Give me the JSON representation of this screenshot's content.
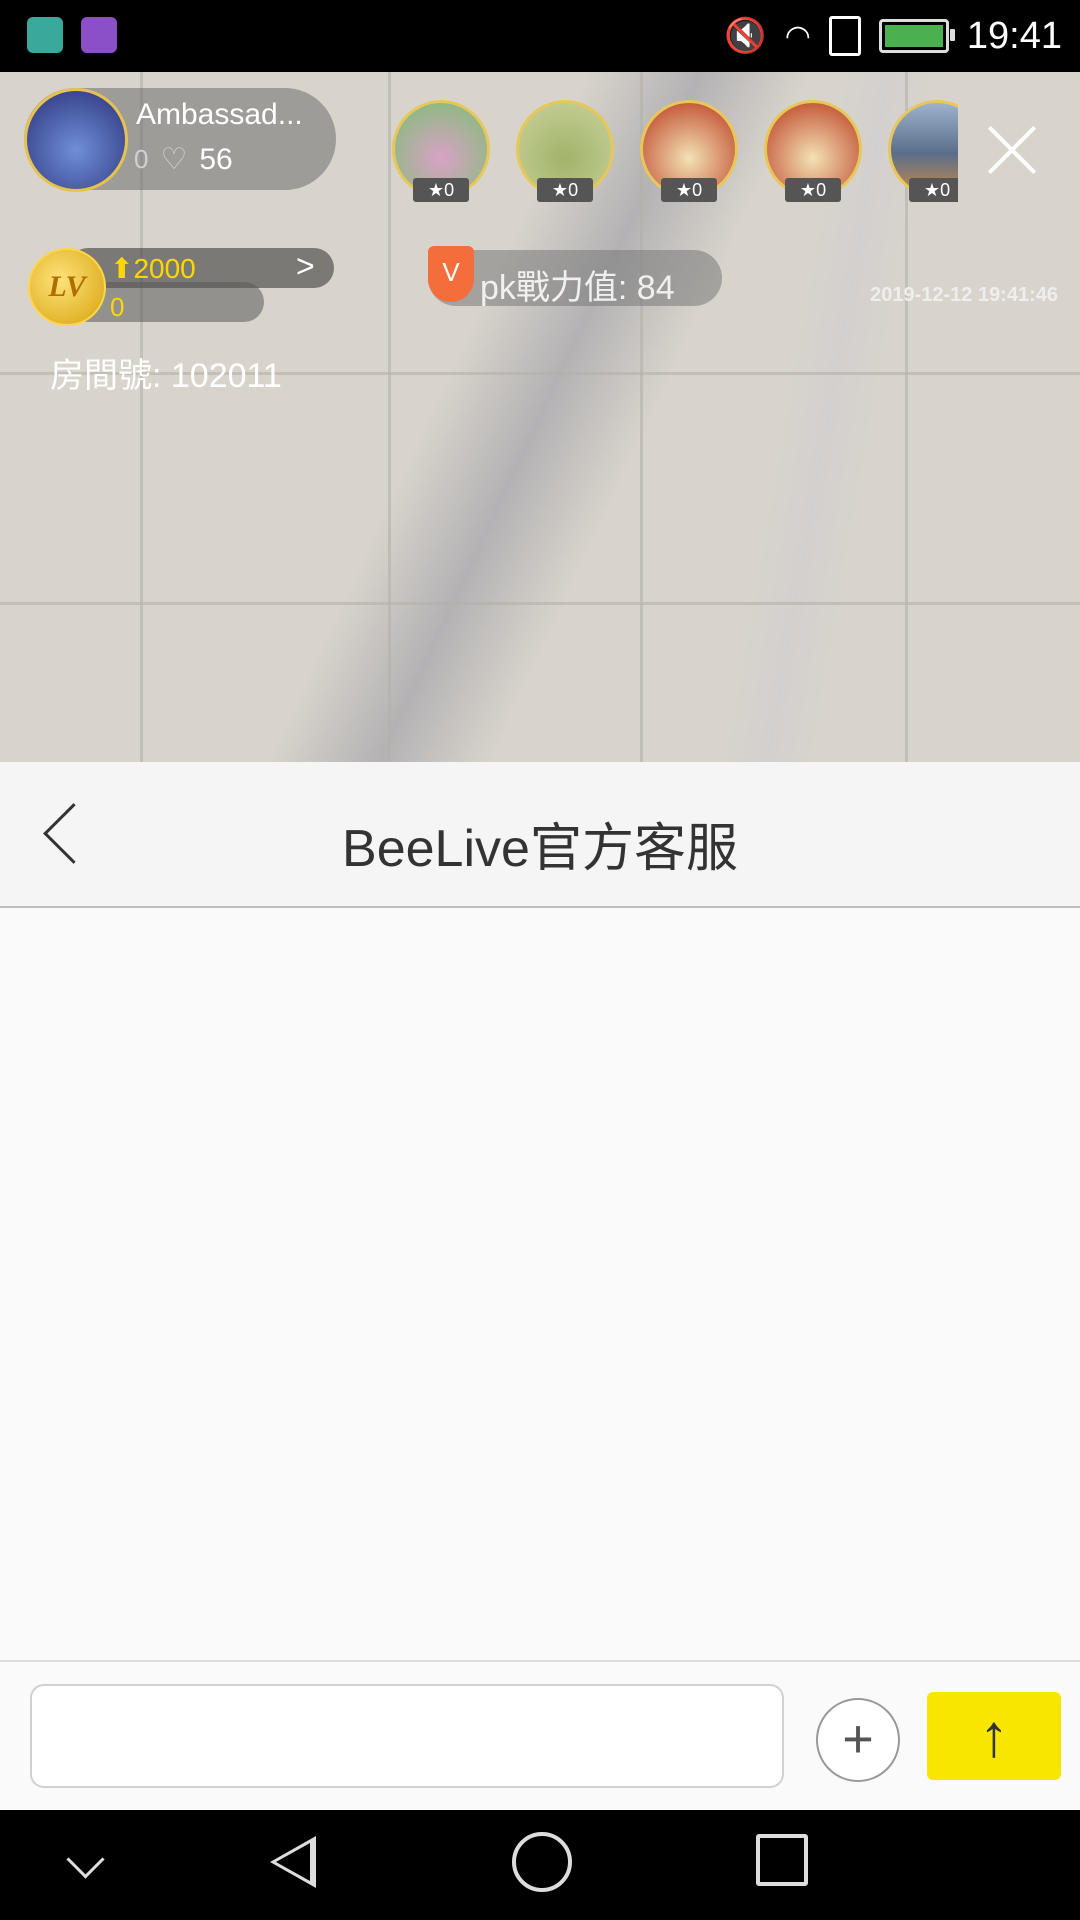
{
  "status_bar": {
    "time": "19:41",
    "icons": [
      "android-app-icon",
      "gallery-app-icon",
      "mute-icon",
      "wifi-icon",
      "sim-icon",
      "battery-charging-icon"
    ]
  },
  "live": {
    "host": {
      "name": "Ambassad...",
      "small_count": "0",
      "likes": "56"
    },
    "viewers": [
      {
        "stars": "0",
        "colors": [
          "#7bbf72",
          "#d9a2c6"
        ]
      },
      {
        "stars": "0",
        "colors": [
          "#c9d39a",
          "#a2b36b"
        ]
      },
      {
        "stars": "0",
        "colors": [
          "#e27b2b",
          "#b9361a"
        ]
      },
      {
        "stars": "0",
        "colors": [
          "#e27b2b",
          "#b9361a"
        ]
      },
      {
        "stars": "0",
        "colors": [
          "#5a6e8a",
          "#c78b4a"
        ]
      }
    ],
    "level": {
      "badge": "LV",
      "target": "2000",
      "current": "0"
    },
    "pk": {
      "label": "pk戰力值: 84",
      "shield": "V"
    },
    "timestamp": "2019-12-12 19:41:46",
    "room": "房間號: 102011"
  },
  "chat": {
    "title": "BeeLive官方客服",
    "input_value": "",
    "input_placeholder": "",
    "plus_label": "+",
    "send_label": "↑"
  },
  "colors": {
    "accent_yellow": "#f8e600",
    "header_bg": "#f5f5f5"
  }
}
